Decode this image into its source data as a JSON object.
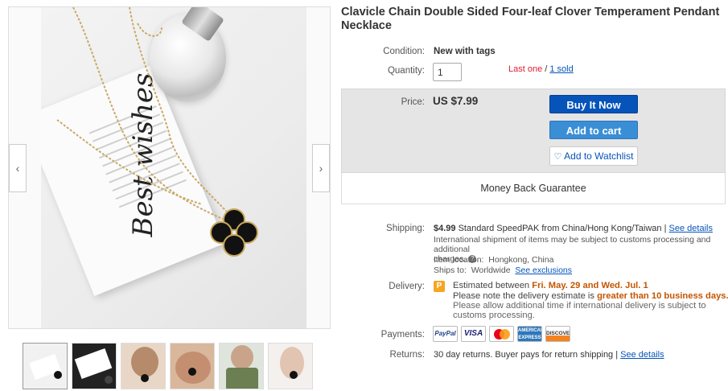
{
  "title": "Clavicle Chain Double Sided Four-leaf Clover Temperament Pendant Necklace",
  "gallery": {
    "card_script": "Best wishes",
    "prev_icon": "chevron-left-icon",
    "next_icon": "chevron-right-icon",
    "thumbnail_count": 6
  },
  "condition": {
    "label": "Condition:",
    "value": "New with tags"
  },
  "quantity": {
    "label": "Quantity:",
    "value": "1",
    "last_one": "Last one",
    "separator": " / ",
    "sold": "1 sold"
  },
  "price": {
    "label": "Price:",
    "value": "US $7.99"
  },
  "buttons": {
    "buy_now": "Buy It Now",
    "add_to_cart": "Add to cart",
    "watchlist": "Add to Watchlist",
    "watchlist_icon": "heart-icon"
  },
  "money_back": "Money Back Guarantee",
  "shipping": {
    "label": "Shipping:",
    "cost": "$4.99",
    "method": "Standard SpeedPAK from China/Hong Kong/Taiwan |",
    "see_details": "See details",
    "intl_note_1": "International shipment of items may be subject to customs processing and additional",
    "intl_note_2": "charges.",
    "location_label": "Item location:",
    "location": "Hongkong, China",
    "ships_to_label": "Ships to:",
    "ships_to": "Worldwide",
    "see_exclusions": "See exclusions"
  },
  "delivery": {
    "label": "Delivery:",
    "icon": "P",
    "estimated_prefix": "Estimated between ",
    "estimated_dates": "Fri. May. 29 and Wed. Jul. 1",
    "note_prefix": "Please note the delivery estimate is ",
    "note_highlight": "greater than 10 business days.",
    "note_2": "Please allow additional time if international delivery is subject to",
    "note_3": "customs processing."
  },
  "payments": {
    "label": "Payments:",
    "logos": [
      "PayPal",
      "VISA",
      "MasterCard",
      "AMERICAN EXPRESS",
      "DISCOVER"
    ]
  },
  "returns": {
    "label": "Returns:",
    "value": "30 day returns. Buyer pays for return shipping |",
    "see_details": "See details"
  },
  "colors": {
    "buy_now": "#0654ba",
    "add_to_cart": "#3a8ed6",
    "link": "#0654ba",
    "alert_red": "#dd1e31",
    "delivery_orange": "#c45500"
  }
}
